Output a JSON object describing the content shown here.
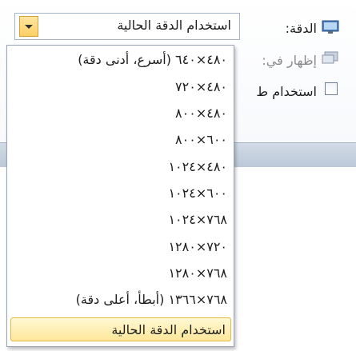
{
  "window": {
    "resolution_label": "الدقة:",
    "show_on_label": "إظهار في:",
    "media_label": "استخدام ط"
  },
  "resolution_combo": {
    "value": "استخدام الدقة الحالية",
    "options": [
      {
        "label": "٤٨٠×٦٤٠ (أسرع، أدنى دقة)",
        "selected": false
      },
      {
        "label": "٤٨٠×٧٢٠",
        "selected": false
      },
      {
        "label": "٤٨٠×٨٠٠",
        "selected": false
      },
      {
        "label": "٦٠٠×٨٠٠",
        "selected": false
      },
      {
        "label": "٤٨٠×١٠٢٤",
        "selected": false
      },
      {
        "label": "٦٠٠×١٠٢٤",
        "selected": false
      },
      {
        "label": "٧٦٨×١٠٢٤",
        "selected": false
      },
      {
        "label": "٧٢٠×١٢٨٠",
        "selected": false
      },
      {
        "label": "٧٦٨×١٢٨٠",
        "selected": false
      },
      {
        "label": "٧٦٨×١٣٦٦ (أبطأ، أعلى دقة)",
        "selected": false
      },
      {
        "label": "استخدام الدقة الحالية",
        "selected": true
      }
    ]
  },
  "colors": {
    "accent_highlight": "#ffe79a",
    "accent_border": "#e3b743",
    "disabled_text": "#8a8a8a"
  }
}
